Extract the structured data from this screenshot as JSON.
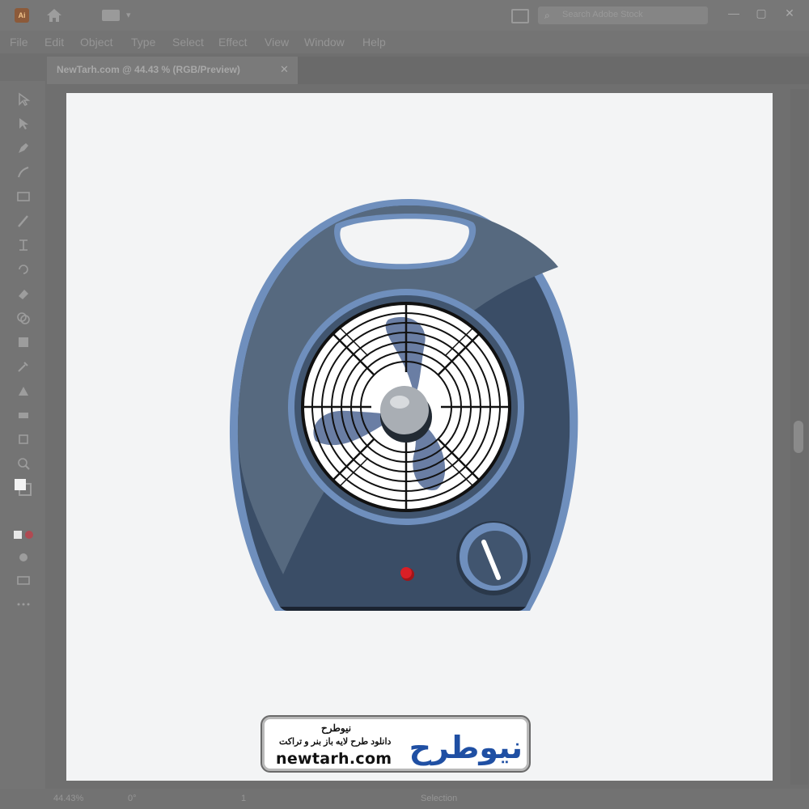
{
  "app": {
    "logo_text": "Ai"
  },
  "search": {
    "placeholder": "Search Adobe Stock"
  },
  "window_controls": {
    "minimize": "—",
    "maximize": "▢",
    "close": "✕"
  },
  "menu": [
    "File",
    "Edit",
    "Object",
    "Type",
    "Select",
    "Effect",
    "View",
    "Window",
    "Help"
  ],
  "document": {
    "tab_title": "NewTarh.com @ 44.43 % (RGB/Preview)",
    "close_symbol": "✕"
  },
  "status": {
    "zoom": "44.43%",
    "rotate": "0°",
    "artboard": "1",
    "mode": "Selection"
  },
  "watermark": {
    "name_fa": "نیوطرح",
    "tagline_fa": "دانلود طرح لایه باز بنر و تراکت",
    "url": "newtarh.com",
    "logo_fa": "نیوطرح"
  },
  "colors": {
    "fan_body": "#3a4d66",
    "fan_rim": "#6f8fbd",
    "fan_highlight": "#56697f",
    "blade": "#6a7ea4",
    "grille": "#111111",
    "hub": "#a9aeb4",
    "indicator_red": "#d91f26",
    "logo_red": "#e01e26",
    "logo_blue": "#1f4fa3"
  }
}
